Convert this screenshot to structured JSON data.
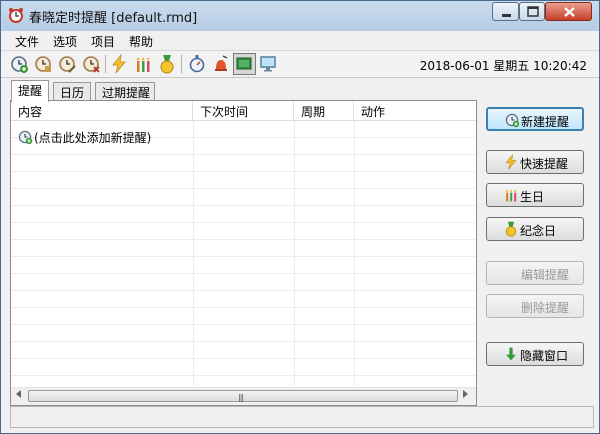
{
  "window": {
    "title": "春晓定时提醒 [default.rmd]"
  },
  "menu": [
    "文件",
    "选项",
    "项目",
    "帮助"
  ],
  "toolbar": {
    "icons": [
      "add-reminder-icon",
      "reminder-clock-icon",
      "reminder-edit-icon",
      "reminder-delete-icon",
      "quick-reminder-icon",
      "birthday-icon",
      "anniversary-icon",
      "stopwatch-icon",
      "alarm-bell-icon",
      "window-mode-icon",
      "monitor-icon"
    ],
    "datetime": "2018-06-01 星期五 10:20:42"
  },
  "tabs": [
    "提醒",
    "日历",
    "过期提醒"
  ],
  "list": {
    "columns": [
      "内容",
      "下次时间",
      "周期",
      "动作"
    ],
    "add_hint": "(点击此处添加新提醒)"
  },
  "actions": {
    "new_reminder": "新建提醒",
    "quick_reminder": "快速提醒",
    "birthday": "生日",
    "anniversary": "纪念日",
    "edit_reminder": "编辑提醒",
    "delete_reminder": "删除提醒",
    "hide_window": "隐藏窗口"
  },
  "colors": {
    "accent": "#3c7fb1",
    "title_bar": "#c9dbee",
    "close_button": "#c7402a"
  }
}
